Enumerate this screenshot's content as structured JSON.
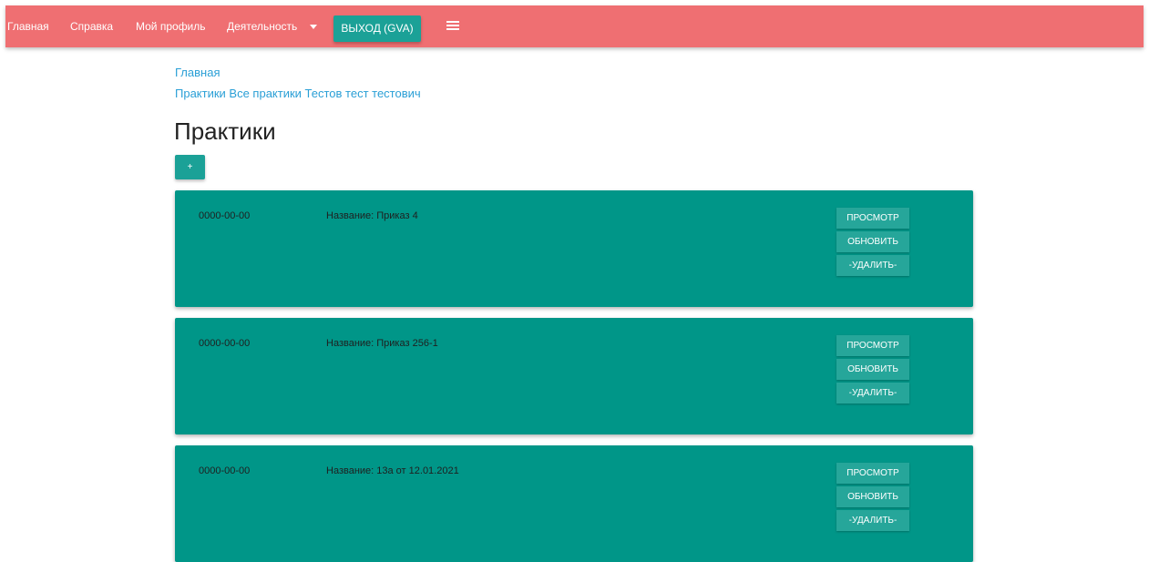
{
  "navbar": {
    "links": [
      "Главная",
      "Справка",
      "Мой профиль",
      "Деятельность"
    ],
    "exit_label": "ВЫХОД (GVA)",
    "menu_icon": "hamburger-menu-icon",
    "dropdown_icon": "caret-down-icon",
    "background_color": "#ef6f72",
    "button_color": "#1ba197"
  },
  "breadcrumb": {
    "home": "Главная",
    "path": "Практики Все практики Тестов тест тестович"
  },
  "page": {
    "title": "Практики",
    "add_button_label": "+"
  },
  "practices": [
    {
      "date": "0000-00-00",
      "name": "Название: Приказ 4",
      "actions": {
        "view": "ПРОСМОТР",
        "update": "ОБНОВИТЬ",
        "delete": "-УДАЛИТЬ-"
      }
    },
    {
      "date": "0000-00-00",
      "name": "Название: Приказ 256-1",
      "actions": {
        "view": "ПРОСМОТР",
        "update": "ОБНОВИТЬ",
        "delete": "-УДАЛИТЬ-"
      }
    },
    {
      "date": "0000-00-00",
      "name": "Название: 13а от 12.01.2021",
      "actions": {
        "view": "ПРОСМОТР",
        "update": "ОБНОВИТЬ",
        "delete": "-УДАЛИТЬ-"
      }
    }
  ],
  "colors": {
    "card": "#009688",
    "card_button": "#26a69a",
    "link": "#2a9fd6"
  }
}
